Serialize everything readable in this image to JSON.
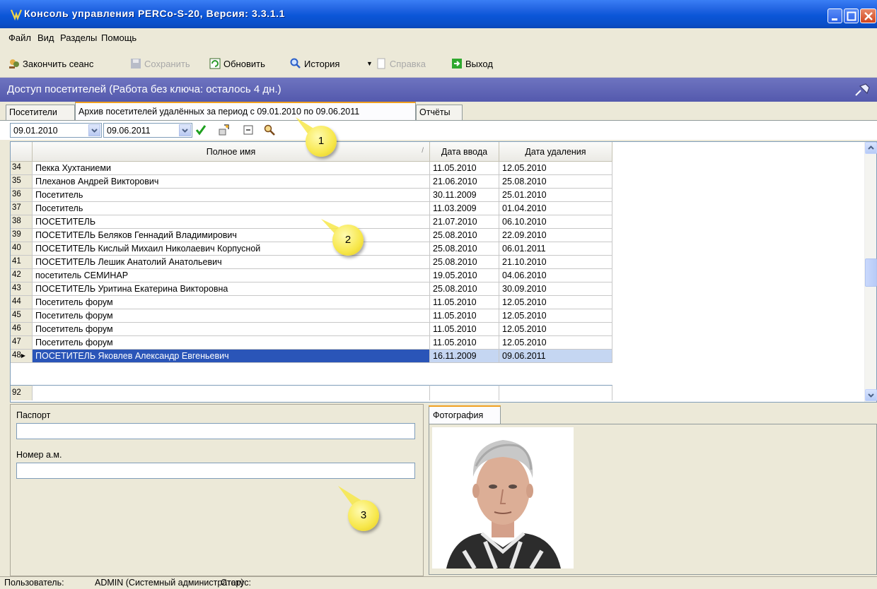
{
  "window": {
    "title": "Консоль управления PERCo-S-20, Версия: 3.3.1.1"
  },
  "menu": [
    "Файл",
    "Вид",
    "Разделы",
    "Помощь"
  ],
  "toolbar": {
    "end_session": "Закончить сеанс",
    "save": "Сохранить",
    "refresh": "Обновить",
    "history": "История",
    "help": "Справка",
    "exit": "Выход"
  },
  "section": {
    "title": "Доступ посетителей (Работа без ключа: осталось 4 дн.)"
  },
  "tabs": [
    "Посетители",
    "Архив посетителей удалённых за период с 09.01.2010 по 09.06.2011",
    "Отчёты"
  ],
  "filter": {
    "date_from": "09.01.2010",
    "date_to": "09.06.2011"
  },
  "grid": {
    "columns": [
      "Полное имя",
      "Дата ввода",
      "Дата удаления"
    ],
    "sort_marker": "/",
    "rows": [
      {
        "n": "34",
        "name": "Пекка Хухтаниеми",
        "in": "11.05.2010",
        "out": "12.05.2010"
      },
      {
        "n": "35",
        "name": "Плеханов Андрей Викторович",
        "in": "21.06.2010",
        "out": "25.08.2010"
      },
      {
        "n": "36",
        "name": "Посетитель",
        "in": "30.11.2009",
        "out": "25.01.2010"
      },
      {
        "n": "37",
        "name": "Посетитель",
        "in": "11.03.2009",
        "out": "01.04.2010"
      },
      {
        "n": "38",
        "name": "ПОСЕТИТЕЛЬ",
        "in": "21.07.2010",
        "out": "06.10.2010"
      },
      {
        "n": "39",
        "name": "ПОСЕТИТЕЛЬ  Беляков Геннадий Владимирович",
        "in": "25.08.2010",
        "out": "22.09.2010"
      },
      {
        "n": "40",
        "name": "ПОСЕТИТЕЛЬ Кислый Михаил Николаевич Корпусной",
        "in": "25.08.2010",
        "out": "06.01.2011"
      },
      {
        "n": "41",
        "name": "ПОСЕТИТЕЛЬ Лешик Анатолий Анатольевич",
        "in": "25.08.2010",
        "out": "21.10.2010"
      },
      {
        "n": "42",
        "name": "посетитель СЕМИНАР",
        "in": "19.05.2010",
        "out": "04.06.2010"
      },
      {
        "n": "43",
        "name": "ПОСЕТИТЕЛЬ Уритина Екатерина Викторовна",
        "in": "25.08.2010",
        "out": "30.09.2010"
      },
      {
        "n": "44",
        "name": "Посетитель форум",
        "in": "11.05.2010",
        "out": "12.05.2010"
      },
      {
        "n": "45",
        "name": "Посетитель форум",
        "in": "11.05.2010",
        "out": "12.05.2010"
      },
      {
        "n": "46",
        "name": "Посетитель форум",
        "in": "11.05.2010",
        "out": "12.05.2010"
      },
      {
        "n": "47",
        "name": "Посетитель форум",
        "in": "11.05.2010",
        "out": "12.05.2010"
      },
      {
        "n": "48",
        "name": "ПОСЕТИТЕЛЬ Яковлев Александр Евгеньевич",
        "in": "16.11.2009",
        "out": "09.06.2011",
        "selected": true
      }
    ],
    "total": "92"
  },
  "details": {
    "passport_label": "Паспорт",
    "car_label": "Номер а.м."
  },
  "photo": {
    "tab_label": "Фотография"
  },
  "status": {
    "user_label": "Пользователь:",
    "user_value": "ADMIN (Системный администратор)",
    "status_label": "Статус:"
  },
  "callouts": [
    "1",
    "2",
    "3"
  ],
  "colors": {
    "titlebar": "#0a4fc9",
    "section_header": "#5c61b3",
    "selected_row": "#2a55b8",
    "callout": "#f7e74a"
  }
}
